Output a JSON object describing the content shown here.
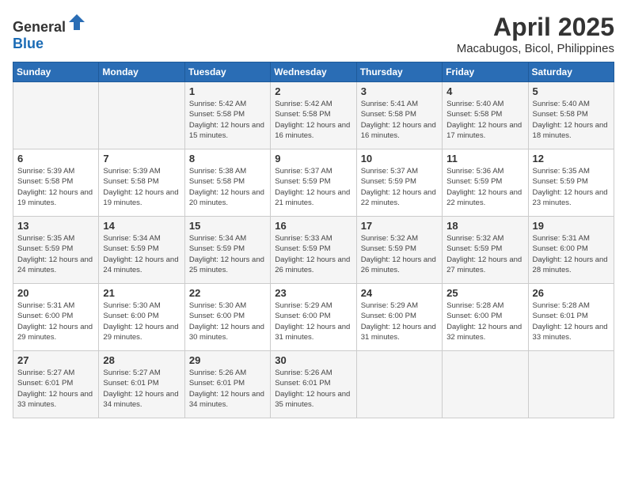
{
  "header": {
    "logo_general": "General",
    "logo_blue": "Blue",
    "month": "April 2025",
    "location": "Macabugos, Bicol, Philippines"
  },
  "weekdays": [
    "Sunday",
    "Monday",
    "Tuesday",
    "Wednesday",
    "Thursday",
    "Friday",
    "Saturday"
  ],
  "weeks": [
    [
      {
        "day": "",
        "info": ""
      },
      {
        "day": "",
        "info": ""
      },
      {
        "day": "1",
        "info": "Sunrise: 5:42 AM\nSunset: 5:58 PM\nDaylight: 12 hours and 15 minutes."
      },
      {
        "day": "2",
        "info": "Sunrise: 5:42 AM\nSunset: 5:58 PM\nDaylight: 12 hours and 16 minutes."
      },
      {
        "day": "3",
        "info": "Sunrise: 5:41 AM\nSunset: 5:58 PM\nDaylight: 12 hours and 16 minutes."
      },
      {
        "day": "4",
        "info": "Sunrise: 5:40 AM\nSunset: 5:58 PM\nDaylight: 12 hours and 17 minutes."
      },
      {
        "day": "5",
        "info": "Sunrise: 5:40 AM\nSunset: 5:58 PM\nDaylight: 12 hours and 18 minutes."
      }
    ],
    [
      {
        "day": "6",
        "info": "Sunrise: 5:39 AM\nSunset: 5:58 PM\nDaylight: 12 hours and 19 minutes."
      },
      {
        "day": "7",
        "info": "Sunrise: 5:39 AM\nSunset: 5:58 PM\nDaylight: 12 hours and 19 minutes."
      },
      {
        "day": "8",
        "info": "Sunrise: 5:38 AM\nSunset: 5:58 PM\nDaylight: 12 hours and 20 minutes."
      },
      {
        "day": "9",
        "info": "Sunrise: 5:37 AM\nSunset: 5:59 PM\nDaylight: 12 hours and 21 minutes."
      },
      {
        "day": "10",
        "info": "Sunrise: 5:37 AM\nSunset: 5:59 PM\nDaylight: 12 hours and 22 minutes."
      },
      {
        "day": "11",
        "info": "Sunrise: 5:36 AM\nSunset: 5:59 PM\nDaylight: 12 hours and 22 minutes."
      },
      {
        "day": "12",
        "info": "Sunrise: 5:35 AM\nSunset: 5:59 PM\nDaylight: 12 hours and 23 minutes."
      }
    ],
    [
      {
        "day": "13",
        "info": "Sunrise: 5:35 AM\nSunset: 5:59 PM\nDaylight: 12 hours and 24 minutes."
      },
      {
        "day": "14",
        "info": "Sunrise: 5:34 AM\nSunset: 5:59 PM\nDaylight: 12 hours and 24 minutes."
      },
      {
        "day": "15",
        "info": "Sunrise: 5:34 AM\nSunset: 5:59 PM\nDaylight: 12 hours and 25 minutes."
      },
      {
        "day": "16",
        "info": "Sunrise: 5:33 AM\nSunset: 5:59 PM\nDaylight: 12 hours and 26 minutes."
      },
      {
        "day": "17",
        "info": "Sunrise: 5:32 AM\nSunset: 5:59 PM\nDaylight: 12 hours and 26 minutes."
      },
      {
        "day": "18",
        "info": "Sunrise: 5:32 AM\nSunset: 5:59 PM\nDaylight: 12 hours and 27 minutes."
      },
      {
        "day": "19",
        "info": "Sunrise: 5:31 AM\nSunset: 6:00 PM\nDaylight: 12 hours and 28 minutes."
      }
    ],
    [
      {
        "day": "20",
        "info": "Sunrise: 5:31 AM\nSunset: 6:00 PM\nDaylight: 12 hours and 29 minutes."
      },
      {
        "day": "21",
        "info": "Sunrise: 5:30 AM\nSunset: 6:00 PM\nDaylight: 12 hours and 29 minutes."
      },
      {
        "day": "22",
        "info": "Sunrise: 5:30 AM\nSunset: 6:00 PM\nDaylight: 12 hours and 30 minutes."
      },
      {
        "day": "23",
        "info": "Sunrise: 5:29 AM\nSunset: 6:00 PM\nDaylight: 12 hours and 31 minutes."
      },
      {
        "day": "24",
        "info": "Sunrise: 5:29 AM\nSunset: 6:00 PM\nDaylight: 12 hours and 31 minutes."
      },
      {
        "day": "25",
        "info": "Sunrise: 5:28 AM\nSunset: 6:00 PM\nDaylight: 12 hours and 32 minutes."
      },
      {
        "day": "26",
        "info": "Sunrise: 5:28 AM\nSunset: 6:01 PM\nDaylight: 12 hours and 33 minutes."
      }
    ],
    [
      {
        "day": "27",
        "info": "Sunrise: 5:27 AM\nSunset: 6:01 PM\nDaylight: 12 hours and 33 minutes."
      },
      {
        "day": "28",
        "info": "Sunrise: 5:27 AM\nSunset: 6:01 PM\nDaylight: 12 hours and 34 minutes."
      },
      {
        "day": "29",
        "info": "Sunrise: 5:26 AM\nSunset: 6:01 PM\nDaylight: 12 hours and 34 minutes."
      },
      {
        "day": "30",
        "info": "Sunrise: 5:26 AM\nSunset: 6:01 PM\nDaylight: 12 hours and 35 minutes."
      },
      {
        "day": "",
        "info": ""
      },
      {
        "day": "",
        "info": ""
      },
      {
        "day": "",
        "info": ""
      }
    ]
  ]
}
